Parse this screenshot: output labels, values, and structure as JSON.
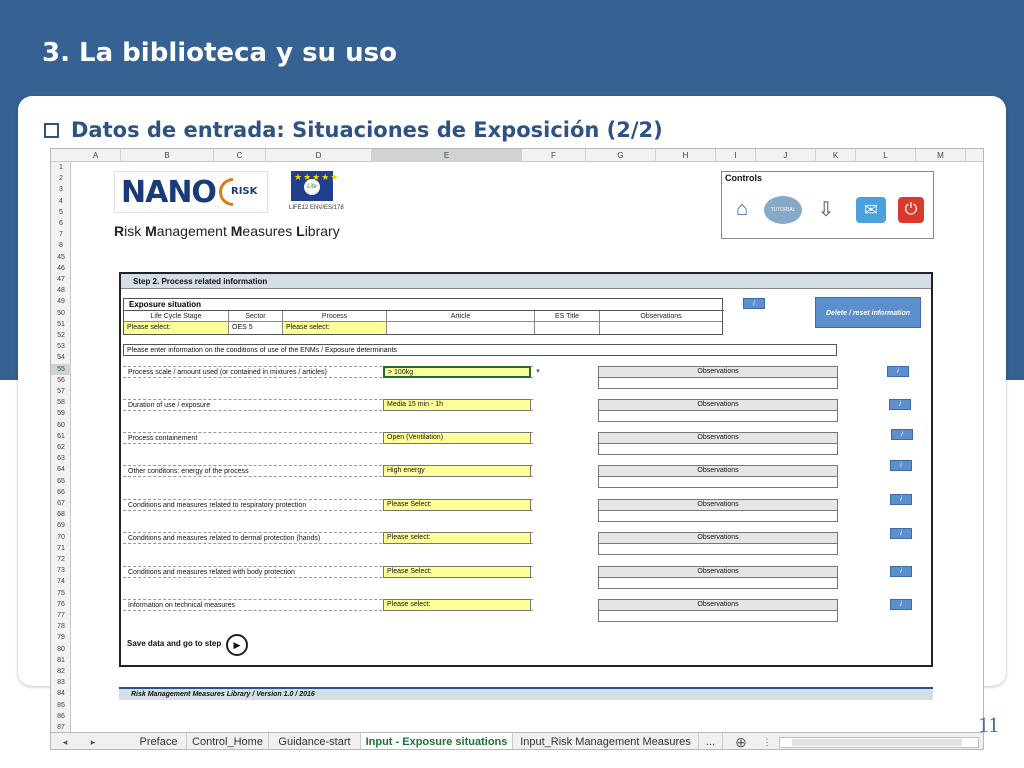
{
  "slide": {
    "title": "3. La biblioteca y su uso",
    "bullet": "Datos de entrada: Situaciones de Exposición (2/2)",
    "page_number": "11"
  },
  "spreadsheet": {
    "columns": [
      "A",
      "B",
      "C",
      "D",
      "E",
      "F",
      "G",
      "H",
      "I",
      "J",
      "K",
      "L",
      "M"
    ],
    "selected_column": "E",
    "rows": [
      "1",
      "2",
      "3",
      "4",
      "5",
      "6",
      "7",
      "8",
      "45",
      "46",
      "47",
      "48",
      "49",
      "50",
      "51",
      "52",
      "53",
      "54",
      "55",
      "56",
      "57",
      "58",
      "59",
      "60",
      "61",
      "62",
      "63",
      "64",
      "65",
      "66",
      "67",
      "68",
      "69",
      "70",
      "71",
      "72",
      "73",
      "74",
      "75",
      "76",
      "77",
      "78",
      "79",
      "80",
      "81",
      "82",
      "83",
      "84",
      "85",
      "86",
      "87"
    ],
    "selected_row": "55",
    "nano_logo": "NANO",
    "nano_logo_suffix": "RISK",
    "life_code": "LIFE12 ENV/ES/178",
    "life_badge": "Life",
    "library_title_parts": [
      "R",
      "isk ",
      "M",
      "anagement ",
      "M",
      "easures ",
      "L",
      "ibrary"
    ],
    "controls": {
      "label": "Controls",
      "tutorial_label": "TUTORIAL",
      "icons": [
        "home-icon",
        "tutorial-icon",
        "save-icon",
        "mail-icon",
        "power-icon"
      ]
    },
    "step": {
      "header": "Step 2. Process related information",
      "exposure_situation": {
        "title": "Exposure situation",
        "columns": [
          "Life Cycle Stage",
          "Sector",
          "Process",
          "Article",
          "ES Title",
          "Observations"
        ],
        "values": [
          "Please select:",
          "OES 5",
          "Please select:",
          "",
          "",
          ""
        ]
      },
      "info_button": "i",
      "delete_button": "Delete / reset information",
      "enter_info": "Please enter information on the conditions of use of the ENMs / Exposure determinants",
      "fields": [
        {
          "label": "Process scale / amount used (or contained in mixtures / articles)",
          "value": "> 100kg",
          "obs": "Observations"
        },
        {
          "label": "Duration of use / exposure",
          "value": "Media 15 min - 1h",
          "obs": "Observations"
        },
        {
          "label": "Process containement",
          "value": "Open (Ventilation)",
          "obs": "Observations"
        },
        {
          "label": "Other conditons: energy of the process",
          "value": "High energy",
          "obs": "Observations"
        },
        {
          "label": "Conditions and measures related to respiratory protection",
          "value": "Please Select:",
          "obs": "Observations"
        },
        {
          "label": "Conditions and measures related to dermal protection (hands)",
          "value": "Please select:",
          "obs": "Observations"
        },
        {
          "label": "Conditions and measures related with body protection",
          "value": "Please Select:",
          "obs": "Observations"
        },
        {
          "label": "Information on technical measures",
          "value": "Please select:",
          "obs": "Observations"
        }
      ],
      "save_label": "Save data and go to step"
    },
    "footer": "Risk Management Measures Library / Version 1.0 / 2016",
    "tabs": [
      "Preface",
      "Control_Home",
      "Guidance-start",
      "Input - Exposure situations",
      "Input_Risk Management Measures",
      "..."
    ],
    "active_tab": "Input - Exposure situations",
    "colors": {
      "header_blue": "#356293",
      "title_blue": "#2e5283",
      "yellow_input": "#ffff9a",
      "button_blue": "#5b8fcd",
      "active_tab_green": "#1f6e3a"
    }
  }
}
